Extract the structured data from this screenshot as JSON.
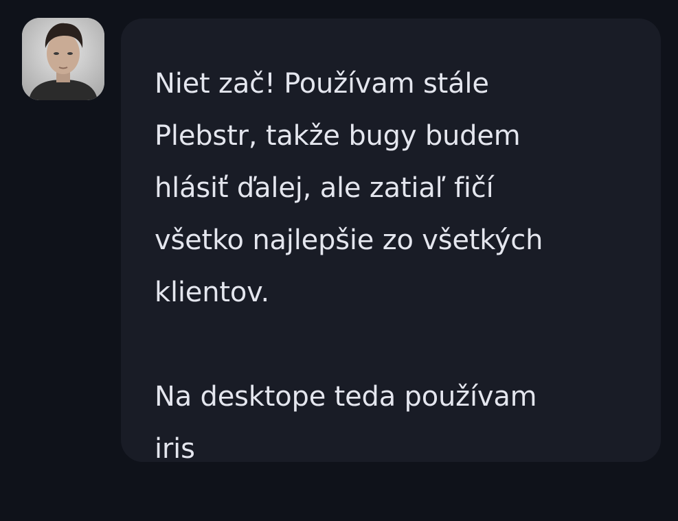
{
  "message": {
    "avatar_icon": "user-avatar-photo",
    "text": "Niet zač! Používam stále\nPlebstr, takže bugy budem\nhlásiť ďalej, ale zatiaľ fičí\nvšetko najlepšie zo všetkých\nklientov.\n\nNa desktope teda používam\niris"
  },
  "colors": {
    "background": "#0f121a",
    "bubble": "#191c26",
    "text": "#e4e6ee"
  }
}
